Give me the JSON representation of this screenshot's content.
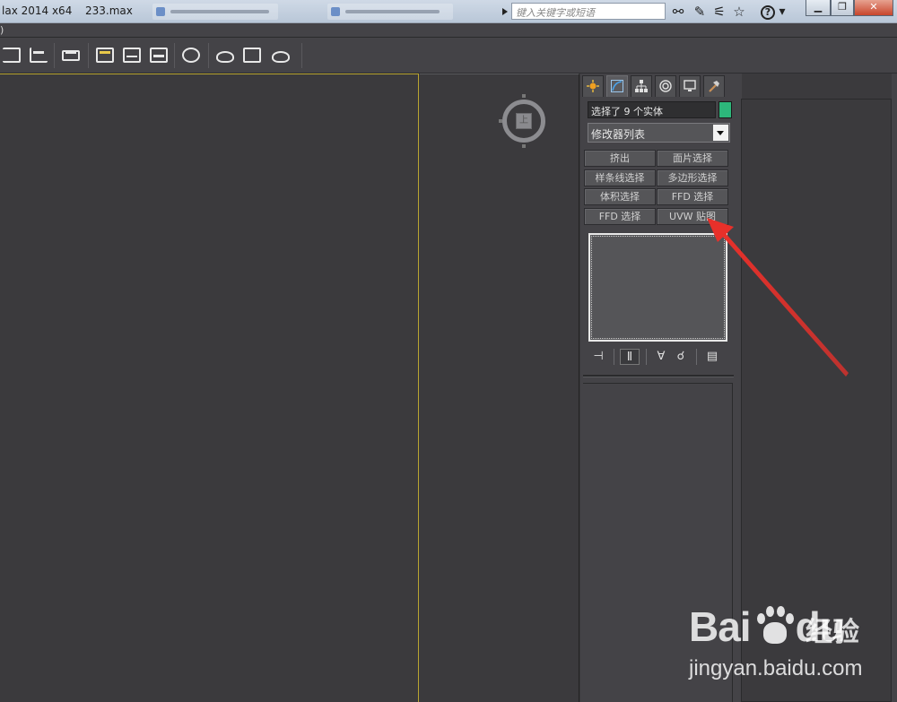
{
  "titlebar": {
    "app_title": "lax  2014 x64",
    "file_name": "233.max",
    "search_placeholder": "键入关键字或短语",
    "icons": [
      "binoculars-icon",
      "wrench-icon",
      "satellite-icon",
      "star-icon"
    ],
    "help_glyph": "?",
    "window_buttons": [
      "minimize",
      "restore",
      "close"
    ]
  },
  "menubar": {
    "fragment": ")"
  },
  "command_panel": {
    "tabs": [
      "create",
      "modify",
      "hierarchy",
      "motion",
      "display",
      "utilities"
    ],
    "active_tab": "modify",
    "selection_text": "选择了 9 个实体",
    "object_color": "#2db77b",
    "modifier_list_label": "修改器列表",
    "modifier_buttons": [
      "挤出",
      "面片选择",
      "样条线选择",
      "多边形选择",
      "体积选择",
      "FFD 选择",
      "FFD 选择",
      "UVW 贴图"
    ]
  },
  "viewport": {
    "viewcube_label": "上"
  },
  "annotation": {
    "color": "#e8302a",
    "target": "UVW 贴图"
  },
  "watermark": {
    "brand": "Bai",
    "brand_suffix": "du",
    "cn": "经验",
    "url": "jingyan.baidu.com"
  }
}
